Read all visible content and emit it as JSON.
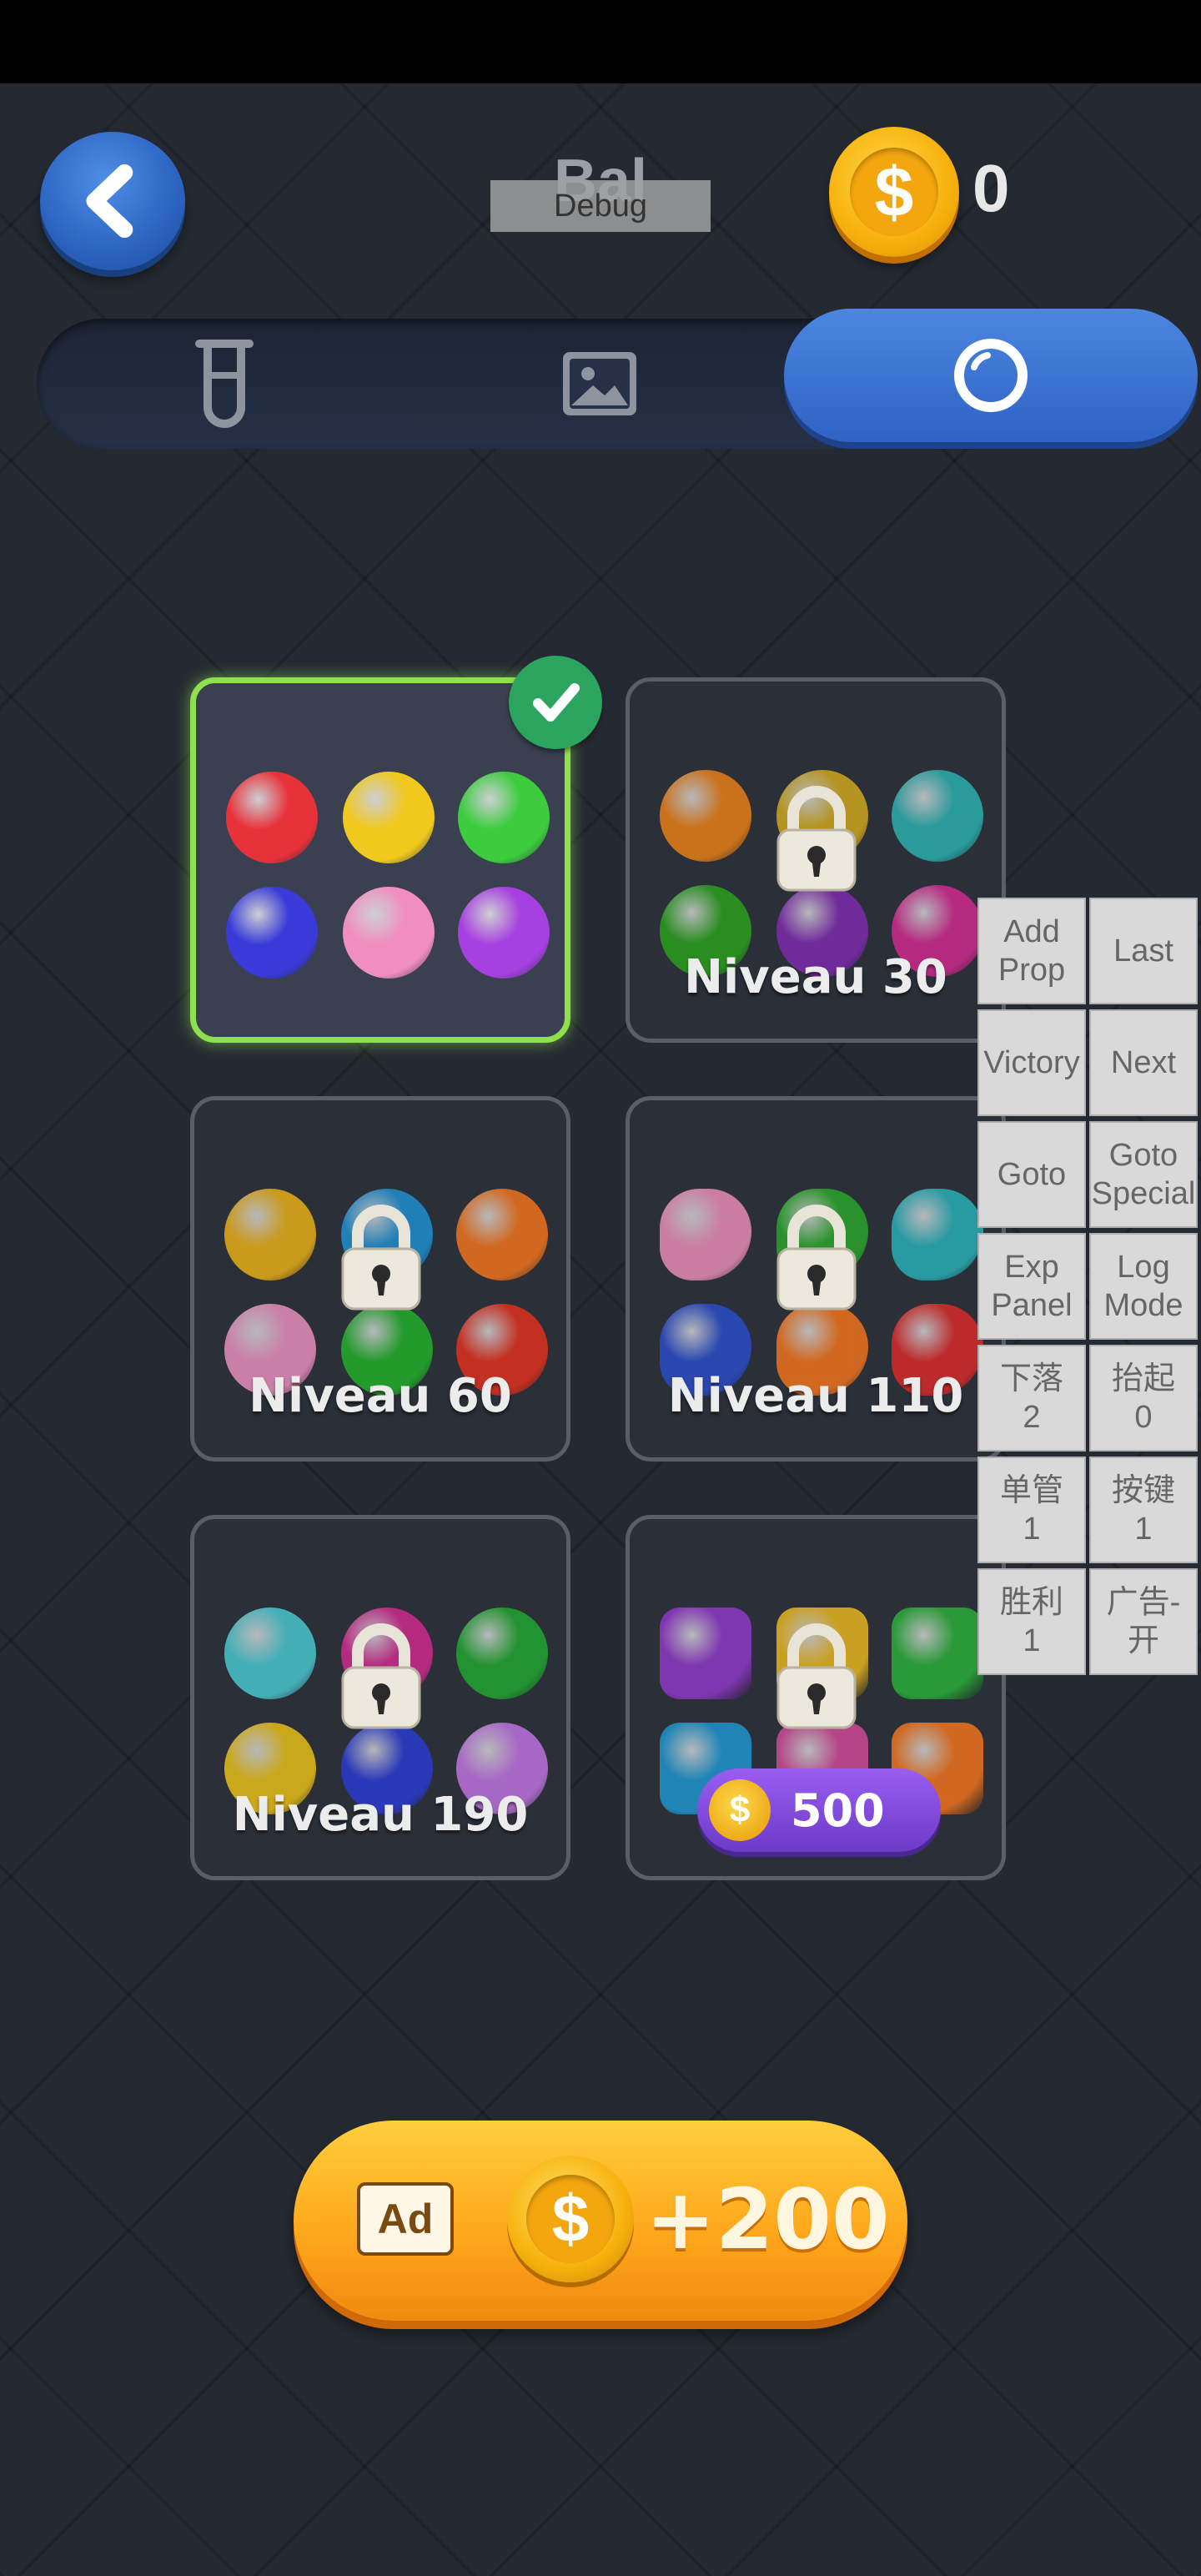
{
  "header": {
    "title": "Bal",
    "debug_label": "Debug",
    "coin_count": "0",
    "coin_symbol": "$"
  },
  "tabs": [
    {
      "name": "tube",
      "icon": "test-tube-icon",
      "active": false
    },
    {
      "name": "image",
      "icon": "image-icon",
      "active": false
    },
    {
      "name": "ball",
      "icon": "ring-icon",
      "active": true
    }
  ],
  "levels": [
    {
      "label": "",
      "locked": false,
      "selected": true,
      "colors": [
        "#e8323a",
        "#f0c81e",
        "#3ccc3e",
        "#3a3ad8",
        "#f08ec0",
        "#a640e0"
      ]
    },
    {
      "label": "Niveau 30",
      "locked": true,
      "colors": [
        "#e07a18",
        "#c8a21e",
        "#2aa8a8",
        "#2a9a1e",
        "#7a2aa8",
        "#c82a8a"
      ]
    },
    {
      "label": "Niveau 60",
      "locked": true,
      "colors": [
        "#e0a818",
        "#1e8ac8",
        "#e8701e",
        "#e08ab8",
        "#22a82a",
        "#d8301e"
      ]
    },
    {
      "label": "Niveau 110",
      "locked": true,
      "colors": [
        "#e088b0",
        "#2aa02a",
        "#28a8b0",
        "#2a4ac0",
        "#e8701e",
        "#d02a2a"
      ]
    },
    {
      "label": "Niveau 190",
      "locked": true,
      "colors": [
        "#48c0c8",
        "#c82a8a",
        "#22a030",
        "#e0b818",
        "#2a3ac8",
        "#b870d8"
      ]
    },
    {
      "label": "",
      "locked": true,
      "price": "500",
      "colors": [
        "#8a38c0",
        "#e0b020",
        "#2aa838",
        "#1e90c8",
        "#c84890",
        "#e8701e"
      ]
    }
  ],
  "debug_panel": [
    [
      "Add\nProp",
      "Last"
    ],
    [
      "Victory",
      "Next"
    ],
    [
      "Goto",
      "Goto\nSpecial"
    ],
    [
      "Exp\nPanel",
      "Log\nMode"
    ],
    [
      "下落\n2",
      "抬起\n0"
    ],
    [
      "单管\n1",
      "按键\n1"
    ],
    [
      "胜利\n1",
      "广告-开"
    ]
  ],
  "ad_button": {
    "tag": "Ad",
    "reward": "+200",
    "coin_symbol": "$"
  }
}
